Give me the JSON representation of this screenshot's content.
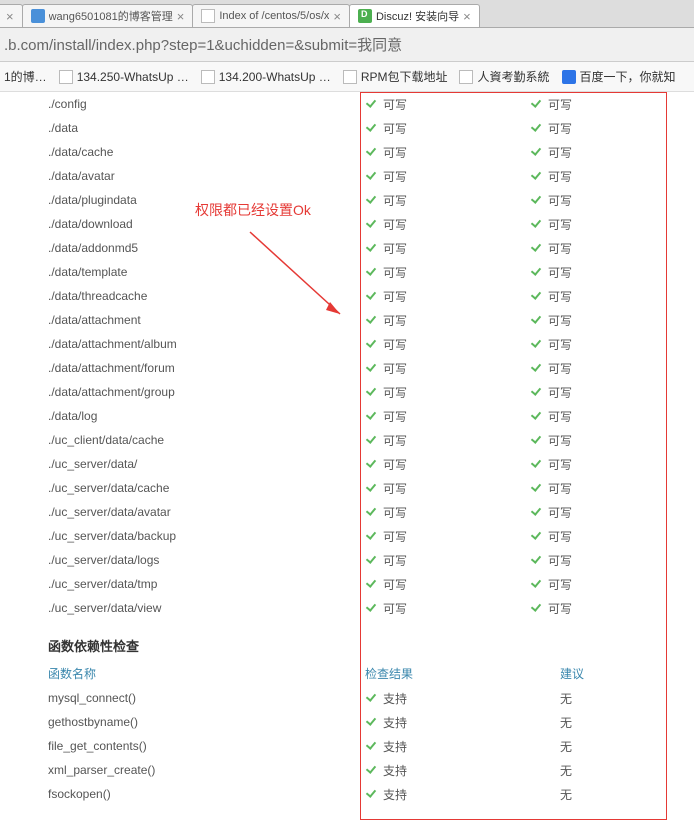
{
  "tabs": [
    {
      "title": ""
    },
    {
      "title": "wang6501081的博客管理"
    },
    {
      "title": "Index of /centos/5/os/x"
    },
    {
      "title": "Discuz! 安装向导",
      "active": true
    }
  ],
  "url": ".b.com/install/index.php?step=1&uchidden=&submit=我同意",
  "bookmarks": [
    {
      "label": "1的博…"
    },
    {
      "label": "134.250-WhatsUp …"
    },
    {
      "label": "134.200-WhatsUp …"
    },
    {
      "label": "RPM包下载地址"
    },
    {
      "label": "人資考勤系統"
    },
    {
      "label": "百度一下，你就知",
      "baidu": true
    }
  ],
  "annotation": "权限都已经设置Ok",
  "status_text": "可写",
  "support_text": "支持",
  "none_text": "无",
  "perm_rows": [
    "./config",
    "./data",
    "./data/cache",
    "./data/avatar",
    "./data/plugindata",
    "./data/download",
    "./data/addonmd5",
    "./data/template",
    "./data/threadcache",
    "./data/attachment",
    "./data/attachment/album",
    "./data/attachment/forum",
    "./data/attachment/group",
    "./data/log",
    "./uc_client/data/cache",
    "./uc_server/data/",
    "./uc_server/data/cache",
    "./uc_server/data/avatar",
    "./uc_server/data/backup",
    "./uc_server/data/logs",
    "./uc_server/data/tmp",
    "./uc_server/data/view"
  ],
  "func_section_title": "函数依赖性检查",
  "func_headers": {
    "name": "函数名称",
    "result": "检查结果",
    "rec": "建议"
  },
  "func_rows": [
    "mysql_connect()",
    "gethostbyname()",
    "file_get_contents()",
    "xml_parser_create()",
    "fsockopen()"
  ]
}
